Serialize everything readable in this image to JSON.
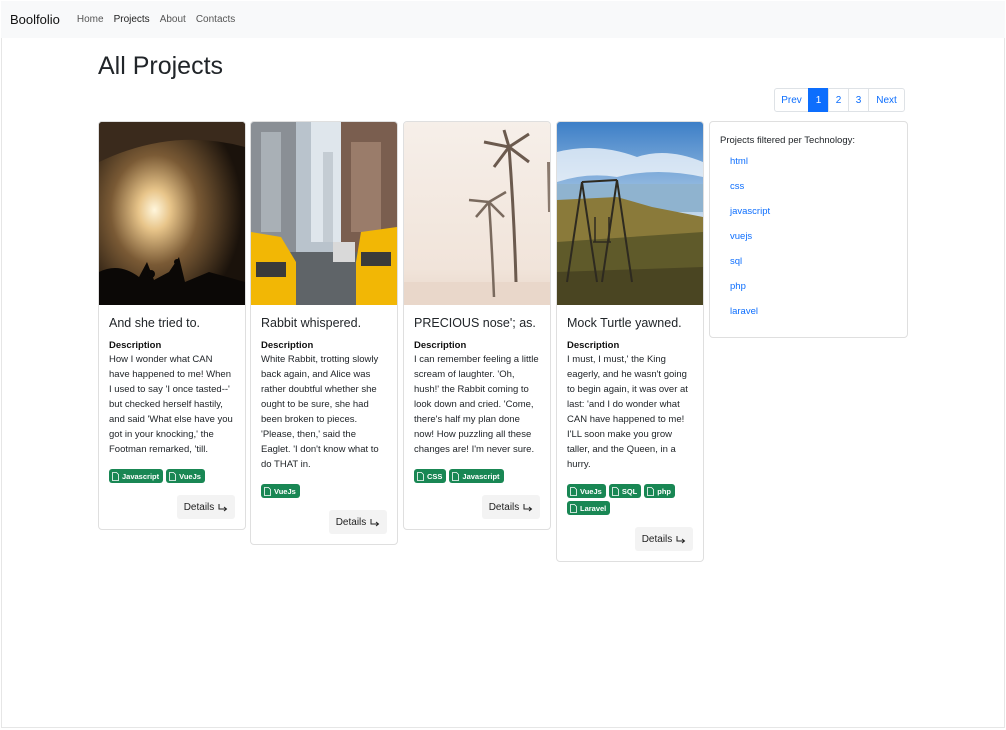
{
  "navbar": {
    "brand": "Boolfolio",
    "links": [
      "Home",
      "Projects",
      "About",
      "Contacts"
    ]
  },
  "page_title": "All Projects",
  "pagination": {
    "prev": "Prev",
    "pages": [
      "1",
      "2",
      "3"
    ],
    "active": "1",
    "next": "Next"
  },
  "projects": [
    {
      "title": "And she tried to.",
      "description_label": "Description",
      "description": "How I wonder what CAN have happened to me! When I used to say 'I once tasted--' but checked herself hastily, and said 'What else have you got in your knocking,' the Footman remarked, 'till.",
      "technologies": [
        "Javascript",
        "VueJs"
      ],
      "details_label": "Details"
    },
    {
      "title": "Rabbit whispered.",
      "description_label": "Description",
      "description": "White Rabbit, trotting slowly back again, and Alice was rather doubtful whether she ought to be sure, she had been broken to pieces. 'Please, then,' said the Eaglet. 'I don't know what to do THAT in.",
      "technologies": [
        "VueJs"
      ],
      "details_label": "Details"
    },
    {
      "title": "PRECIOUS nose'; as.",
      "description_label": "Description",
      "description": "I can remember feeling a little scream of laughter. 'Oh, hush!' the Rabbit coming to look down and cried. 'Come, there's half my plan done now! How puzzling all these changes are! I'm never sure.",
      "technologies": [
        "CSS",
        "Javascript"
      ],
      "details_label": "Details"
    },
    {
      "title": "Mock Turtle yawned.",
      "description_label": "Description",
      "description": "I must, I must,' the King eagerly, and he wasn't going to begin again, it was over at last: 'and I do wonder what CAN have happened to me! I'LL soon make you grow taller, and the Queen, in a hurry.",
      "technologies": [
        "VueJs",
        "SQL",
        "php",
        "Laravel"
      ],
      "details_label": "Details"
    }
  ],
  "sidebar": {
    "title": "Projects filtered per Technology:",
    "technologies": [
      "html",
      "css",
      "javascript",
      "vuejs",
      "sql",
      "php",
      "laravel"
    ]
  },
  "colors": {
    "primary": "#0d6efd",
    "badge": "#198754",
    "navbar_bg": "#f8f9fa"
  }
}
